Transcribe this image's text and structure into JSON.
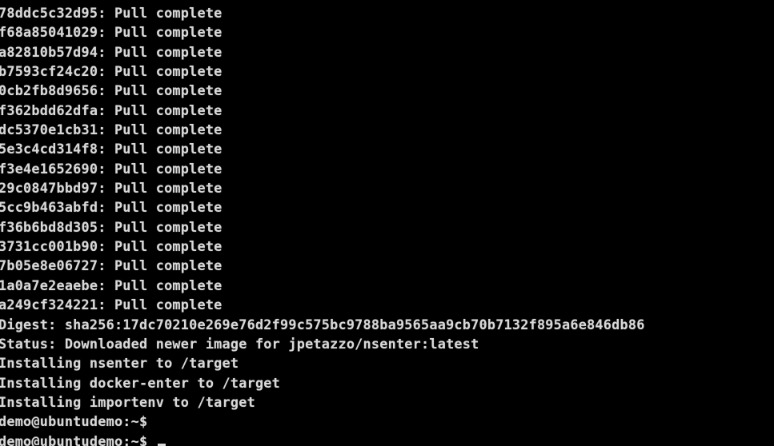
{
  "terminal": {
    "lines": [
      "78ddc5c32d95: Pull complete",
      "f68a85041029: Pull complete",
      "a82810b57d94: Pull complete",
      "b7593cf24c20: Pull complete",
      "0cb2fb8d9656: Pull complete",
      "f362bdd62dfa: Pull complete",
      "dc5370e1cb31: Pull complete",
      "5e3c4cd314f8: Pull complete",
      "f3e4e1652690: Pull complete",
      "29c0847bbd97: Pull complete",
      "5cc9b463abfd: Pull complete",
      "f36b6bd8d305: Pull complete",
      "3731cc001b90: Pull complete",
      "7b05e8e06727: Pull complete",
      "1a0a7e2eaebe: Pull complete",
      "a249cf324221: Pull complete",
      "Digest: sha256:17dc70210e269e76d2f99c575bc9788ba9565aa9cb70b7132f895a6e846db86",
      "Status: Downloaded newer image for jpetazzo/nsenter:latest",
      "Installing nsenter to /target",
      "Installing docker-enter to /target",
      "Installing importenv to /target",
      "demo@ubuntudemo:~$",
      "demo@ubuntudemo:~$ "
    ]
  }
}
